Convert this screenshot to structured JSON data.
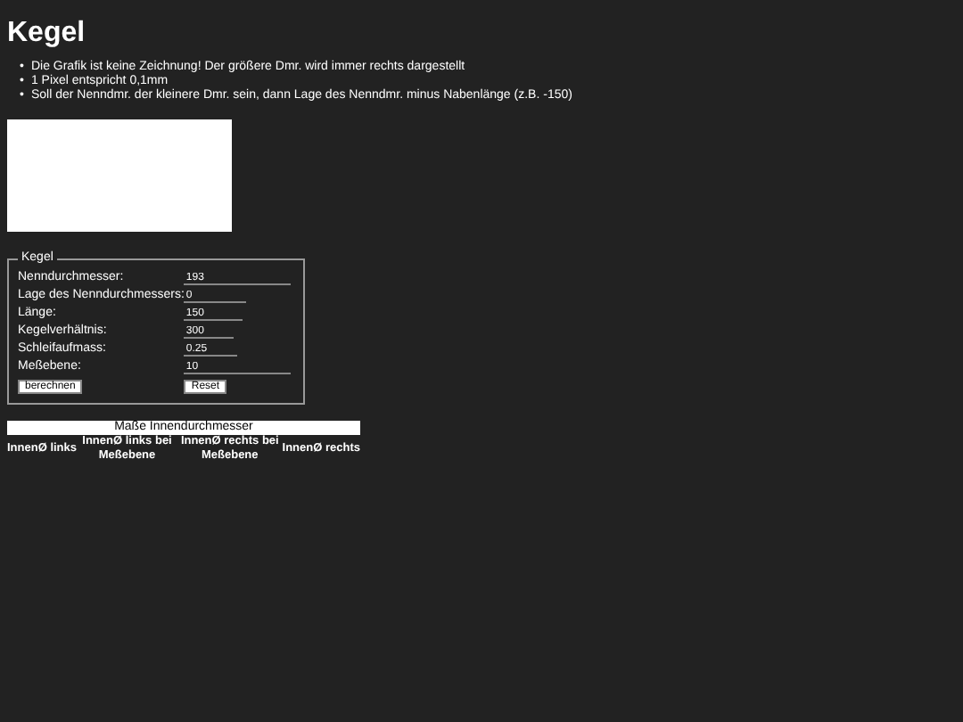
{
  "title": "Kegel",
  "notes": [
    {
      "marker": "•",
      "text": "Die Grafik ist keine Zeichnung! Der größere Dmr. wird immer rechts dargestellt"
    },
    {
      "marker": "•",
      "text": "1 Pixel entspricht 0,1mm"
    },
    {
      "marker": "•",
      "text": "Soll der Nenndmr. der kleinere Dmr. sein, dann Lage des Nenndmr. minus Nabenlänge (z.B. -150)"
    }
  ],
  "form": {
    "legend": "Kegel",
    "fields": [
      {
        "label": "Nenndurchmesser:",
        "value": "193"
      },
      {
        "label": "Lage des Nenndurchmessers:",
        "value": "0"
      },
      {
        "label": "Länge:",
        "value": "150"
      },
      {
        "label": "Kegelverhältnis:",
        "value": "300"
      },
      {
        "label": "Schleifaufmass:",
        "value": "0.25"
      },
      {
        "label": "Meßebene:",
        "value": "10"
      }
    ],
    "buttons": [
      "berechnen",
      "Reset"
    ]
  },
  "table": {
    "caption": "Maße Innendurchmesser",
    "columns": [
      "InnenØ links",
      "InnenØ links bei Meßebene",
      "InnenØ rechts bei Meßebene",
      "InnenØ rechts"
    ]
  }
}
